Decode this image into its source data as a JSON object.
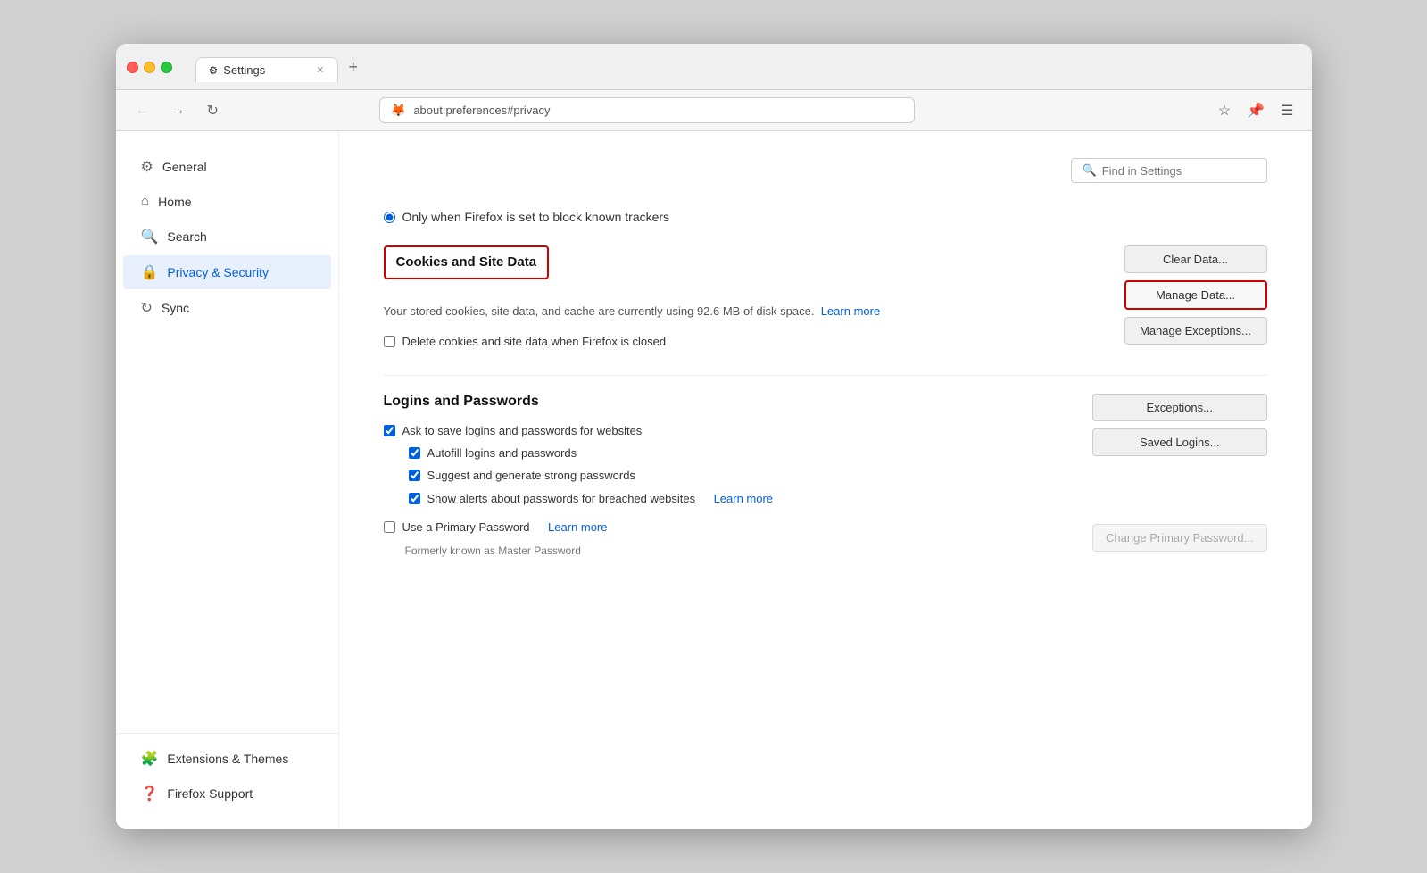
{
  "browser": {
    "tab_title": "Settings",
    "tab_icon": "⚙",
    "address": "about:preferences#privacy",
    "firefox_icon": "🦊"
  },
  "search": {
    "placeholder": "Find in Settings"
  },
  "sidebar": {
    "items": [
      {
        "id": "general",
        "label": "General",
        "icon": "⚙"
      },
      {
        "id": "home",
        "label": "Home",
        "icon": "⌂"
      },
      {
        "id": "search",
        "label": "Search",
        "icon": "🔍"
      },
      {
        "id": "privacy",
        "label": "Privacy & Security",
        "icon": "🔒"
      },
      {
        "id": "sync",
        "label": "Sync",
        "icon": "↻"
      }
    ],
    "bottom_items": [
      {
        "id": "extensions",
        "label": "Extensions & Themes",
        "icon": "🧩"
      },
      {
        "id": "support",
        "label": "Firefox Support",
        "icon": "❓"
      }
    ]
  },
  "main": {
    "radio_option_label": "Only when Firefox is set to block known trackers",
    "cookies_section": {
      "title": "Cookies and Site Data",
      "description": "Your stored cookies, site data, and cache are currently using 92.6 MB of disk space.",
      "learn_more": "Learn more",
      "clear_data_btn": "Clear Data...",
      "manage_data_btn": "Manage Data...",
      "manage_exceptions_btn": "Manage Exceptions...",
      "delete_checkbox_label": "Delete cookies and site data when Firefox is closed"
    },
    "logins_section": {
      "title": "Logins and Passwords",
      "ask_save_label": "Ask to save logins and passwords for websites",
      "autofill_label": "Autofill logins and passwords",
      "suggest_label": "Suggest and generate strong passwords",
      "show_alerts_label": "Show alerts about passwords for breached websites",
      "show_alerts_learn_more": "Learn more",
      "exceptions_btn": "Exceptions...",
      "saved_logins_btn": "Saved Logins...",
      "primary_password_checkbox": "Use a Primary Password",
      "primary_password_learn_more": "Learn more",
      "change_primary_btn": "Change Primary Password...",
      "formerly_known": "Formerly known as Master Password"
    }
  }
}
